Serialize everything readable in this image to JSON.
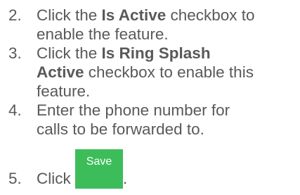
{
  "steps": [
    {
      "number": "2.",
      "line1_pre": "Click the ",
      "line1_bold": "Is Active",
      "line1_post": " checkbox to",
      "line2": "enable the feature."
    },
    {
      "number": "3.",
      "line1_pre": "Click the ",
      "line1_bold": "Is Ring Splash",
      "line2_bold": "Active",
      "line2_post": " checkbox to enable this",
      "line3": "feature."
    },
    {
      "number": "4.",
      "line1": "Enter the phone number for",
      "line2": "calls to be forwarded to."
    },
    {
      "number": "5.",
      "pre": "Click ",
      "button_label": "Save",
      "post": "."
    }
  ],
  "colors": {
    "text": "#595959",
    "save_button_bg": "#3cbd5a",
    "save_button_text": "#ffffff"
  }
}
